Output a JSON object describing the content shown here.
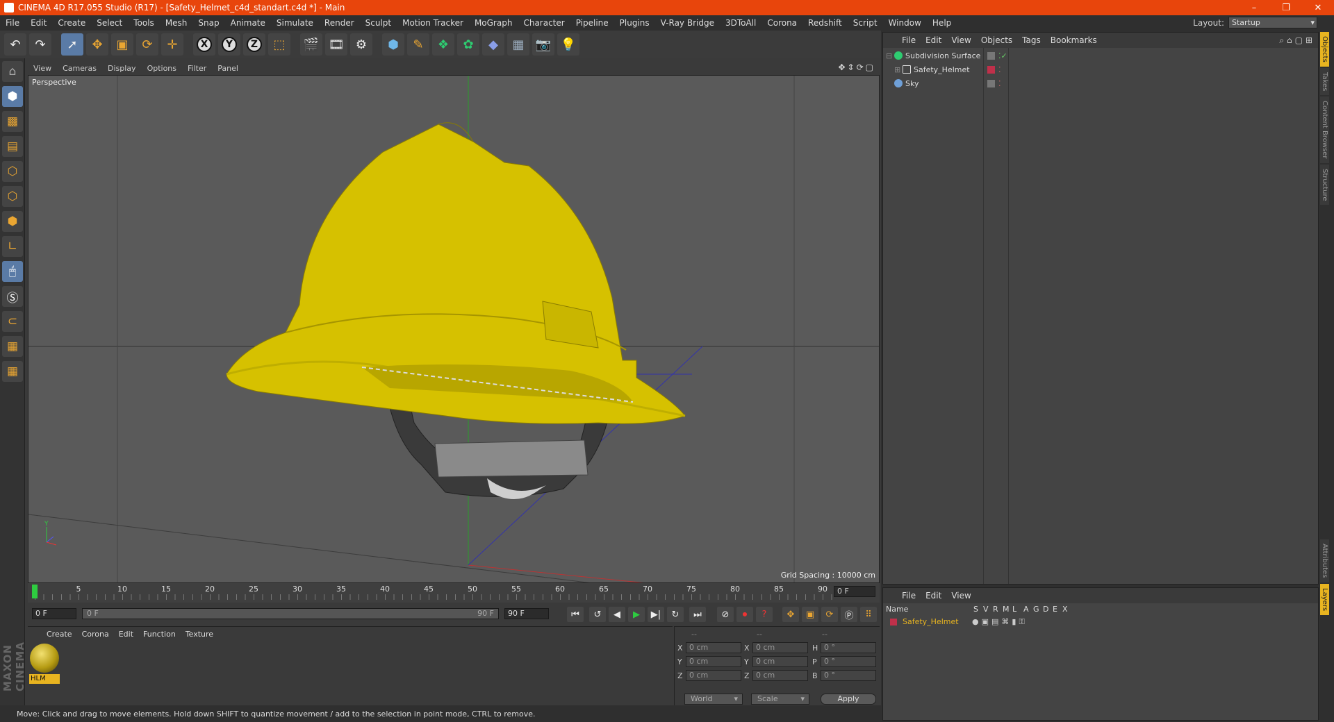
{
  "window": {
    "title": "CINEMA 4D R17.055 Studio (R17) - [Safety_Helmet_c4d_standart.c4d *] - Main",
    "minimize": "–",
    "restore": "❐",
    "close": "✕"
  },
  "menubar": {
    "items": [
      "File",
      "Edit",
      "Create",
      "Select",
      "Tools",
      "Mesh",
      "Snap",
      "Animate",
      "Simulate",
      "Render",
      "Sculpt",
      "Motion Tracker",
      "MoGraph",
      "Character",
      "Pipeline",
      "Plugins",
      "V-Ray Bridge",
      "3DToAll",
      "Corona",
      "Redshift",
      "Script",
      "Window",
      "Help"
    ],
    "layout_label": "Layout:",
    "layout_value": "Startup"
  },
  "toolbar": {
    "axis_x": "X",
    "axis_y": "Y",
    "axis_z": "Z"
  },
  "viewport": {
    "menu": [
      "View",
      "Cameras",
      "Display",
      "Options",
      "Filter",
      "Panel"
    ],
    "label": "Perspective",
    "grid_spacing": "Grid Spacing : 10000 cm",
    "nav_icons": "✥⇕⟳▢"
  },
  "timeline": {
    "ticks": [
      "0",
      "5",
      "10",
      "15",
      "20",
      "25",
      "30",
      "35",
      "40",
      "45",
      "50",
      "55",
      "60",
      "65",
      "70",
      "75",
      "80",
      "85",
      "90"
    ],
    "current_frame": "0 F"
  },
  "transport": {
    "start_field": "0 F",
    "range_start": "0 F",
    "range_end": "90 F",
    "end_field": "90 F"
  },
  "materials": {
    "menu": [
      "Create",
      "Corona",
      "Edit",
      "Function",
      "Texture"
    ],
    "items": [
      {
        "name": "HLM"
      }
    ]
  },
  "coordinates": {
    "headers": [
      "--",
      "--",
      "--"
    ],
    "rows": [
      {
        "a": "X",
        "av": "0 cm",
        "b": "X",
        "bv": "0 cm",
        "c": "H",
        "cv": "0 °"
      },
      {
        "a": "Y",
        "av": "0 cm",
        "b": "Y",
        "bv": "0 cm",
        "c": "P",
        "cv": "0 °"
      },
      {
        "a": "Z",
        "av": "0 cm",
        "b": "Z",
        "bv": "0 cm",
        "c": "B",
        "cv": "0 °"
      }
    ],
    "mode": "World",
    "scale": "Scale",
    "apply": "Apply"
  },
  "status": {
    "text": "Move: Click and drag to move elements. Hold down SHIFT to quantize movement / add to the selection in point mode, CTRL to remove."
  },
  "objects": {
    "menu": [
      "File",
      "Edit",
      "View",
      "Objects",
      "Tags",
      "Bookmarks"
    ],
    "items": [
      {
        "name": "Subdivision Surface",
        "color": "#2ecc71"
      },
      {
        "name": "Safety_Helmet",
        "color": "#e0e0e0"
      },
      {
        "name": "Sky",
        "color": "#6fa0d8"
      }
    ]
  },
  "sidetabs": {
    "top": [
      "Objects",
      "Takes",
      "Content Browser",
      "Structure"
    ],
    "bottom": [
      "Attributes",
      "Layers"
    ]
  },
  "layers": {
    "menu": [
      "File",
      "Edit",
      "View"
    ],
    "columns": [
      "Name",
      "S",
      "V",
      "R",
      "M",
      "L",
      "A",
      "G",
      "D",
      "E",
      "X"
    ],
    "rows": [
      {
        "name": "Safety_Helmet",
        "color": "#c0304a"
      }
    ]
  },
  "colors": {
    "accent": "#e8450c",
    "helmet": "#d6c100",
    "highlight": "#e8b420"
  }
}
